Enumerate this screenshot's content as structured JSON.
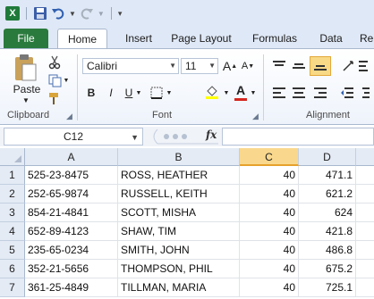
{
  "app": {
    "logo_letter": "X"
  },
  "tabs": [
    "File",
    "Home",
    "Insert",
    "Page Layout",
    "Formulas",
    "Data",
    "Re"
  ],
  "ribbon": {
    "clipboard": {
      "paste_label": "Paste",
      "group_label": "Clipboard"
    },
    "font": {
      "font_name": "Calibri",
      "font_size": "11",
      "bold": "B",
      "italic": "I",
      "underline": "U",
      "grow": "A",
      "shrink": "A",
      "font_color": "A",
      "group_label": "Font"
    },
    "alignment": {
      "group_label": "Alignment"
    }
  },
  "formula_bar": {
    "name_box": "C12",
    "fx_label": "fx",
    "formula_value": ""
  },
  "grid": {
    "columns": [
      "A",
      "B",
      "C",
      "D"
    ],
    "selected_column": "C",
    "rows": [
      {
        "num": "1",
        "a": "525-23-8475",
        "b": "ROSS, HEATHER",
        "c": "40",
        "d": "471.1"
      },
      {
        "num": "2",
        "a": "252-65-9874",
        "b": "RUSSELL, KEITH",
        "c": "40",
        "d": "621.2"
      },
      {
        "num": "3",
        "a": "854-21-4841",
        "b": "SCOTT, MISHA",
        "c": "40",
        "d": "624"
      },
      {
        "num": "4",
        "a": "652-89-4123",
        "b": "SHAW, TIM",
        "c": "40",
        "d": "421.8"
      },
      {
        "num": "5",
        "a": "235-65-0234",
        "b": "SMITH, JOHN",
        "c": "40",
        "d": "486.8"
      },
      {
        "num": "6",
        "a": "352-21-5656",
        "b": "THOMPSON, PHIL",
        "c": "40",
        "d": "675.2"
      },
      {
        "num": "7",
        "a": "361-25-4849",
        "b": "TILLMAN, MARIA",
        "c": "40",
        "d": "725.1"
      }
    ]
  },
  "colors": {
    "file_tab": "#2a7a3d",
    "selected_header": "#f9d88d",
    "accent_red": "#d6261e"
  }
}
